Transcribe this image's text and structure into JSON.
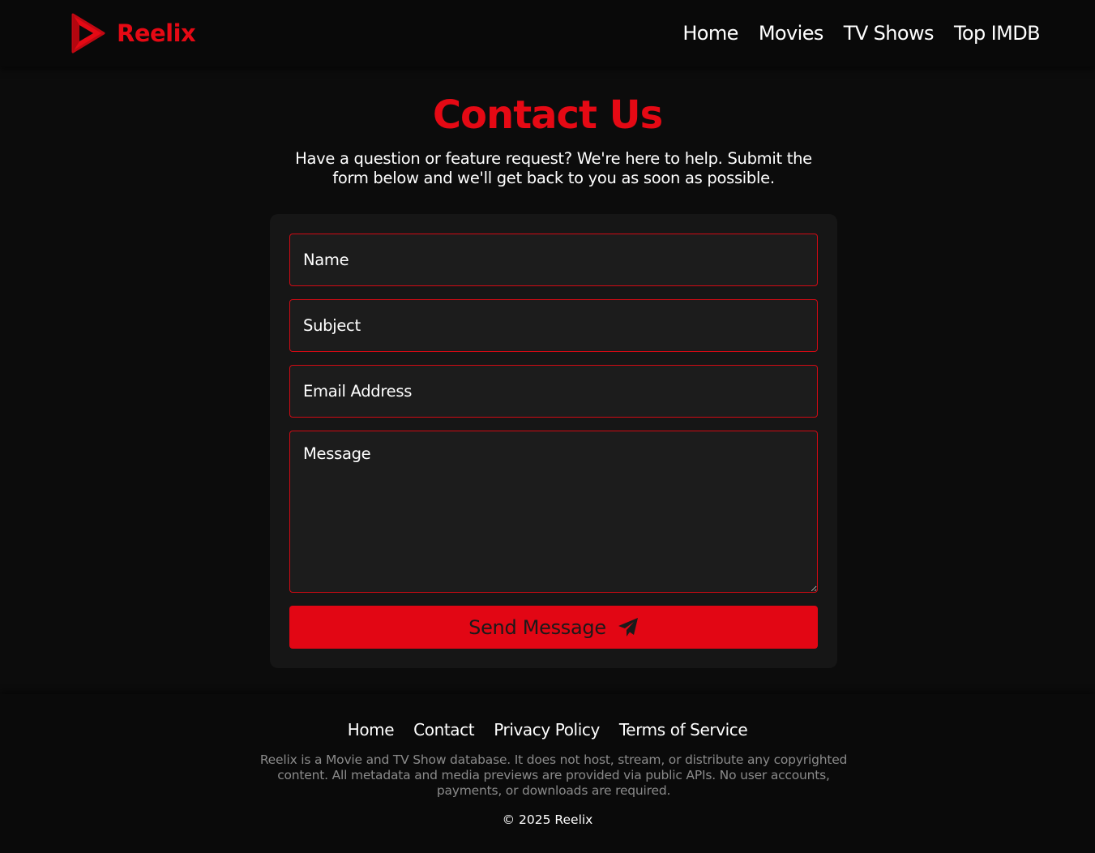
{
  "brand": {
    "name": "Reelix",
    "accent_color": "#e50914",
    "logo_icon": "play-logo-icon"
  },
  "nav": {
    "items": [
      {
        "label": "Home"
      },
      {
        "label": "Movies"
      },
      {
        "label": "TV Shows"
      },
      {
        "label": "Top IMDB"
      }
    ]
  },
  "contact": {
    "title": "Contact Us",
    "intro": "Have a question or feature request? We're here to help. Submit the form below and we'll get back to you as soon as possible.",
    "fields": {
      "name": {
        "placeholder": "Name",
        "value": ""
      },
      "subject": {
        "placeholder": "Subject",
        "value": ""
      },
      "email": {
        "placeholder": "Email Address",
        "value": ""
      },
      "message": {
        "placeholder": "Message",
        "value": ""
      }
    },
    "send_button": {
      "label": "Send Message",
      "icon": "paper-plane-icon",
      "color": "#e20614"
    }
  },
  "footer": {
    "links": [
      {
        "label": "Home"
      },
      {
        "label": "Contact"
      },
      {
        "label": "Privacy Policy"
      },
      {
        "label": "Terms of Service"
      }
    ],
    "disclaimer": "Reelix is a Movie and TV Show database. It does not host, stream, or distribute any copyrighted content. All metadata and media previews are provided via public APIs. No user accounts, payments, or downloads are required.",
    "copyright": "© 2025 Reelix"
  }
}
